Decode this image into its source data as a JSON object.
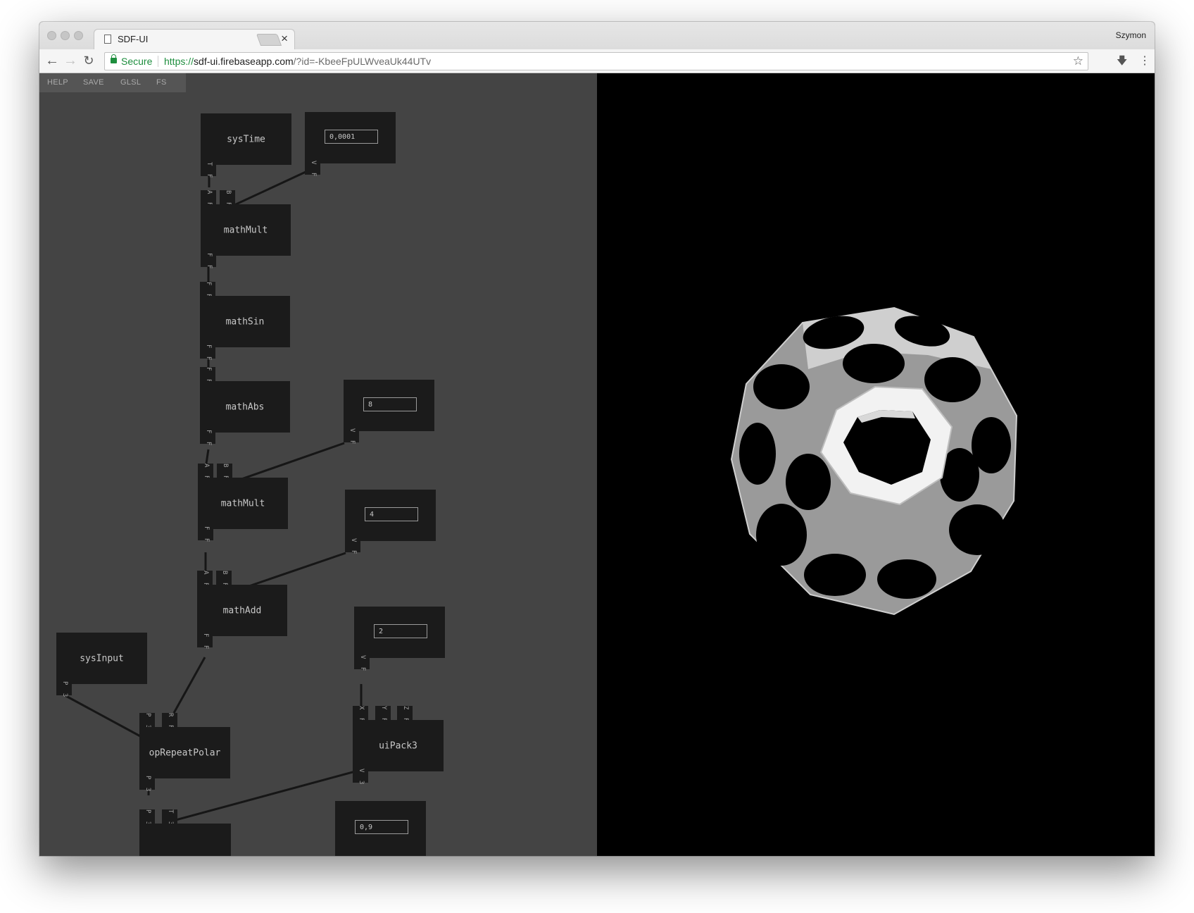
{
  "browser": {
    "tab_title": "SDF-UI",
    "tab_close": "×",
    "profile_name": "Szymon",
    "secure_label": "Secure",
    "url_scheme": "https://",
    "url_host": "sdf-ui.firebaseapp.com",
    "url_rest": "/?id=-KbeeFpULWveaUk44UTv"
  },
  "menu": {
    "help": "HELP",
    "save": "SAVE",
    "glsl": "GLSL",
    "fs": "FS"
  },
  "nodes": {
    "sysTime": {
      "title": "sysTime",
      "out": "T F"
    },
    "val1": {
      "value": "0,0001",
      "out": "V F"
    },
    "mathMult1": {
      "title": "mathMult",
      "in_a": "A F",
      "in_b": "B F",
      "out": "F F"
    },
    "mathSin": {
      "title": "mathSin",
      "in": "F F",
      "out": "F F"
    },
    "mathAbs": {
      "title": "mathAbs",
      "in": "F F",
      "out": "F F"
    },
    "val2": {
      "value": "8",
      "out": "V F"
    },
    "mathMult2": {
      "title": "mathMult",
      "in_a": "A F",
      "in_b": "B F",
      "out": "F F"
    },
    "val3": {
      "value": "4",
      "out": "V F"
    },
    "mathAdd": {
      "title": "mathAdd",
      "in_a": "A F",
      "in_b": "B F",
      "out": "F F"
    },
    "sysInput": {
      "title": "sysInput",
      "out": "P 3"
    },
    "val4": {
      "value": "2",
      "out": "V F"
    },
    "opRepeatPolar": {
      "title": "opRepeatPolar",
      "in_p": "P 3",
      "in_r": "R F",
      "out": "P 3"
    },
    "uiPack3": {
      "title": "uiPack3",
      "in_x": "X F",
      "in_y": "Y F",
      "in_z": "Z F",
      "out": "V 3"
    },
    "bottomNode": {
      "in_p": "P 3",
      "in_t": "T 3"
    },
    "val5": {
      "value": "0,9"
    }
  }
}
